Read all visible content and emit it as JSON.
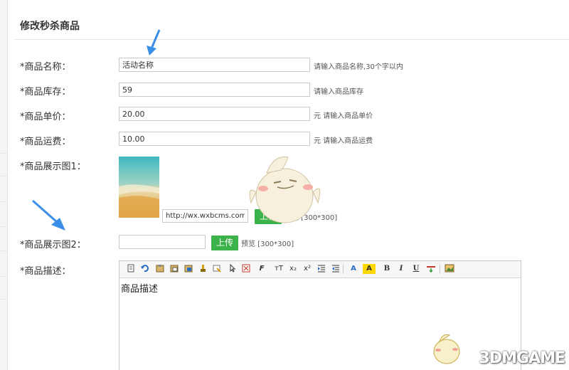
{
  "page": {
    "title": "修改秒杀商品"
  },
  "form": {
    "name": {
      "label": "*商品名称：",
      "value": "活动名称",
      "hint": "请输入商品名称,30个字以内"
    },
    "stock": {
      "label": "*商品库存：",
      "value": "59",
      "hint": "请输入商品库存"
    },
    "price": {
      "label": "*商品单价：",
      "value": "20.00",
      "hint": "元 请输入商品单价"
    },
    "shipping": {
      "label": "*商品运费：",
      "value": "10.00",
      "hint": "元 请输入商品运费"
    },
    "image1": {
      "label": "*商品展示图1：",
      "url_value": "http://wx.wxbcms.com/",
      "upload_label": "上传",
      "preview_text": "预览 [300*300]"
    },
    "image2": {
      "label": "*商品展示图2：",
      "url_value": "",
      "upload_label": "上传",
      "preview_text": "预览 [300*300]"
    },
    "description": {
      "label": "*商品描述：",
      "content": "商品描述",
      "toolbar": [
        "source-icon",
        "undo-icon",
        "paste-icon",
        "paste-text-icon",
        "paste-word-icon",
        "format-brush-icon",
        "clear-format-icon",
        "select-all-icon",
        "fullscreen-icon",
        "font-family-icon",
        "font-size-icon",
        "subscript-icon",
        "superscript-icon",
        "indent-icon",
        "outdent-icon",
        "font-color-icon",
        "highlight-color-icon",
        "bold-icon",
        "italic-icon",
        "underline-icon",
        "horizontal-rule-icon",
        "insert-image-icon"
      ],
      "toolbar_glyphs": {
        "font_family": "F",
        "font_size": "тT",
        "subscript": "x₂",
        "superscript": "x²",
        "font_color": "A",
        "highlight": "A",
        "bold": "B",
        "italic": "I",
        "underline": "U"
      }
    }
  },
  "watermark": {
    "text": "3DMGAME"
  },
  "colors": {
    "upload_button": "#3bb34a",
    "annotation_arrow": "#3a8ee6"
  }
}
